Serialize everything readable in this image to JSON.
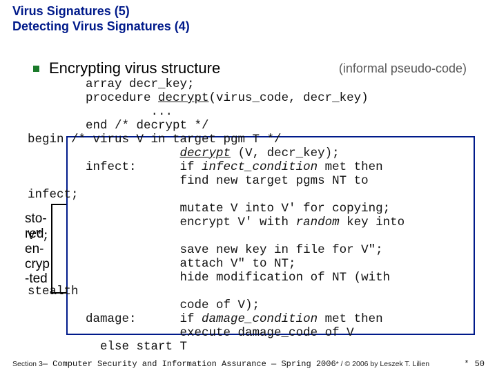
{
  "title": {
    "line1": "Virus Signatures (5)",
    "line2": "Detecting Virus Signatures (4)"
  },
  "heading": {
    "text": "Encrypting virus structure",
    "note": "(informal pseudo-code)"
  },
  "code": {
    "l1": "        array decr_key;",
    "l2a": "        procedure ",
    "l2b": "decrypt",
    "l2c": "(virus_code, decr_key)",
    "l3": "                 ...",
    "l4": "        end /* decrypt */",
    "l5": "begin /* virus V in target pgm T */",
    "l6a": "                     ",
    "l6b": "decrypt",
    "l6c": " (V, decr_key);",
    "l7a": "        infect:      if ",
    "l7b": "infect_condition",
    "l7c": " met then",
    "l8": "                     find new target pgms NT to",
    "l9": "infect;",
    "l10": "                     mutate V into V' for copying;",
    "l11a": "                     encrypt V' with ",
    "l11b": "random",
    "l11c": " key into",
    "l12": "V\";",
    "l13": "                     save new key in file for V\";",
    "l14": "                     attach V\" to NT;",
    "l15": "                     hide modification of NT (with",
    "l16": "stealth",
    "l17": "                     code of V);",
    "l18a": "        damage:      if ",
    "l18b": "damage_condition",
    "l18c": " met then",
    "l19": "                     execute damage_code of V",
    "l20": "          else start T"
  },
  "side": "sto-\nred\nen-\ncryp\n-ted",
  "footer": {
    "left": "Section 3 ",
    "mono1": "— Computer Security and Information Assurance — Spring 2006",
    "right": "  *  /  © 2006 by Leszek T. Lilien",
    "pageno_star": "*",
    "pageno": "50"
  }
}
